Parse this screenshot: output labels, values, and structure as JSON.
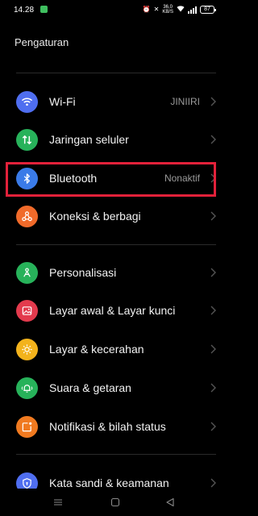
{
  "status_bar": {
    "time": "14.28",
    "network_speed": "36,0",
    "network_unit": "KB/S",
    "battery": "87"
  },
  "header": {
    "title": "Pengaturan"
  },
  "items": [
    {
      "label": "Wi-Fi",
      "value": "JINIIRI",
      "icon": "wifi-icon",
      "color": "#4f6ef0"
    },
    {
      "label": "Jaringan seluler",
      "value": "",
      "icon": "mobile-data-icon",
      "color": "#27b25a"
    },
    {
      "label": "Bluetooth",
      "value": "Nonaktif",
      "icon": "bluetooth-icon",
      "color": "#3a7be8"
    },
    {
      "label": "Koneksi & berbagi",
      "value": "",
      "icon": "connection-sharing-icon",
      "color": "#f06a2a"
    },
    {
      "label": "Personalisasi",
      "value": "",
      "icon": "personalization-icon",
      "color": "#27b25a"
    },
    {
      "label": "Layar awal & Layar kunci",
      "value": "",
      "icon": "home-lock-screen-icon",
      "color": "#e33a4d"
    },
    {
      "label": "Layar & kecerahan",
      "value": "",
      "icon": "display-brightness-icon",
      "color": "#f3b31c"
    },
    {
      "label": "Suara & getaran",
      "value": "",
      "icon": "sound-vibration-icon",
      "color": "#27b25a"
    },
    {
      "label": "Notifikasi & bilah status",
      "value": "",
      "icon": "notification-icon",
      "color": "#f07a20"
    },
    {
      "label": "Kata sandi & keamanan",
      "value": "",
      "icon": "password-security-icon",
      "color": "#4f6ef0"
    }
  ],
  "highlight_color": "#e2213a"
}
